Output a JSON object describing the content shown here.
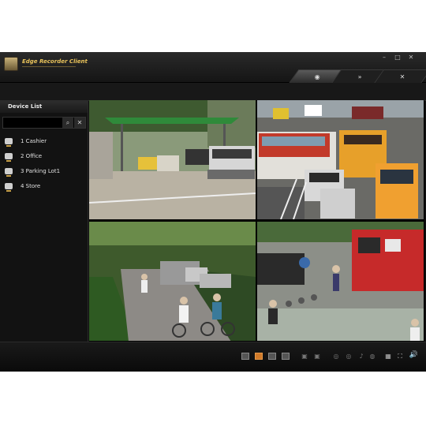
{
  "window": {
    "app_title": "Edge Recorder Client",
    "controls": [
      "–",
      "□",
      "✕"
    ],
    "tabs": [
      {
        "icon": "eye-icon",
        "glyph": "◉",
        "active": true
      },
      {
        "icon": "playback-icon",
        "glyph": "»",
        "active": false
      },
      {
        "icon": "tools-icon",
        "glyph": "✕",
        "active": false
      }
    ]
  },
  "sidebar": {
    "title": "Device List",
    "search_icon": "search-icon",
    "clear_icon": "clear-icon",
    "devices": [
      {
        "label": "1 Cashier"
      },
      {
        "label": "2 Office"
      },
      {
        "label": "3 Parking Lot1"
      },
      {
        "label": "4 Store"
      }
    ]
  },
  "views": [
    {
      "name": "parking-gate-feed"
    },
    {
      "name": "traffic-street-feed"
    },
    {
      "name": "bike-path-feed"
    },
    {
      "name": "sidewalk-plaza-feed"
    }
  ],
  "bottombar": {
    "layouts": [
      "1x1",
      "2x2",
      "3x3",
      "4x4"
    ],
    "active_layout": "2x2",
    "volume_icon": "speaker-icon"
  }
}
